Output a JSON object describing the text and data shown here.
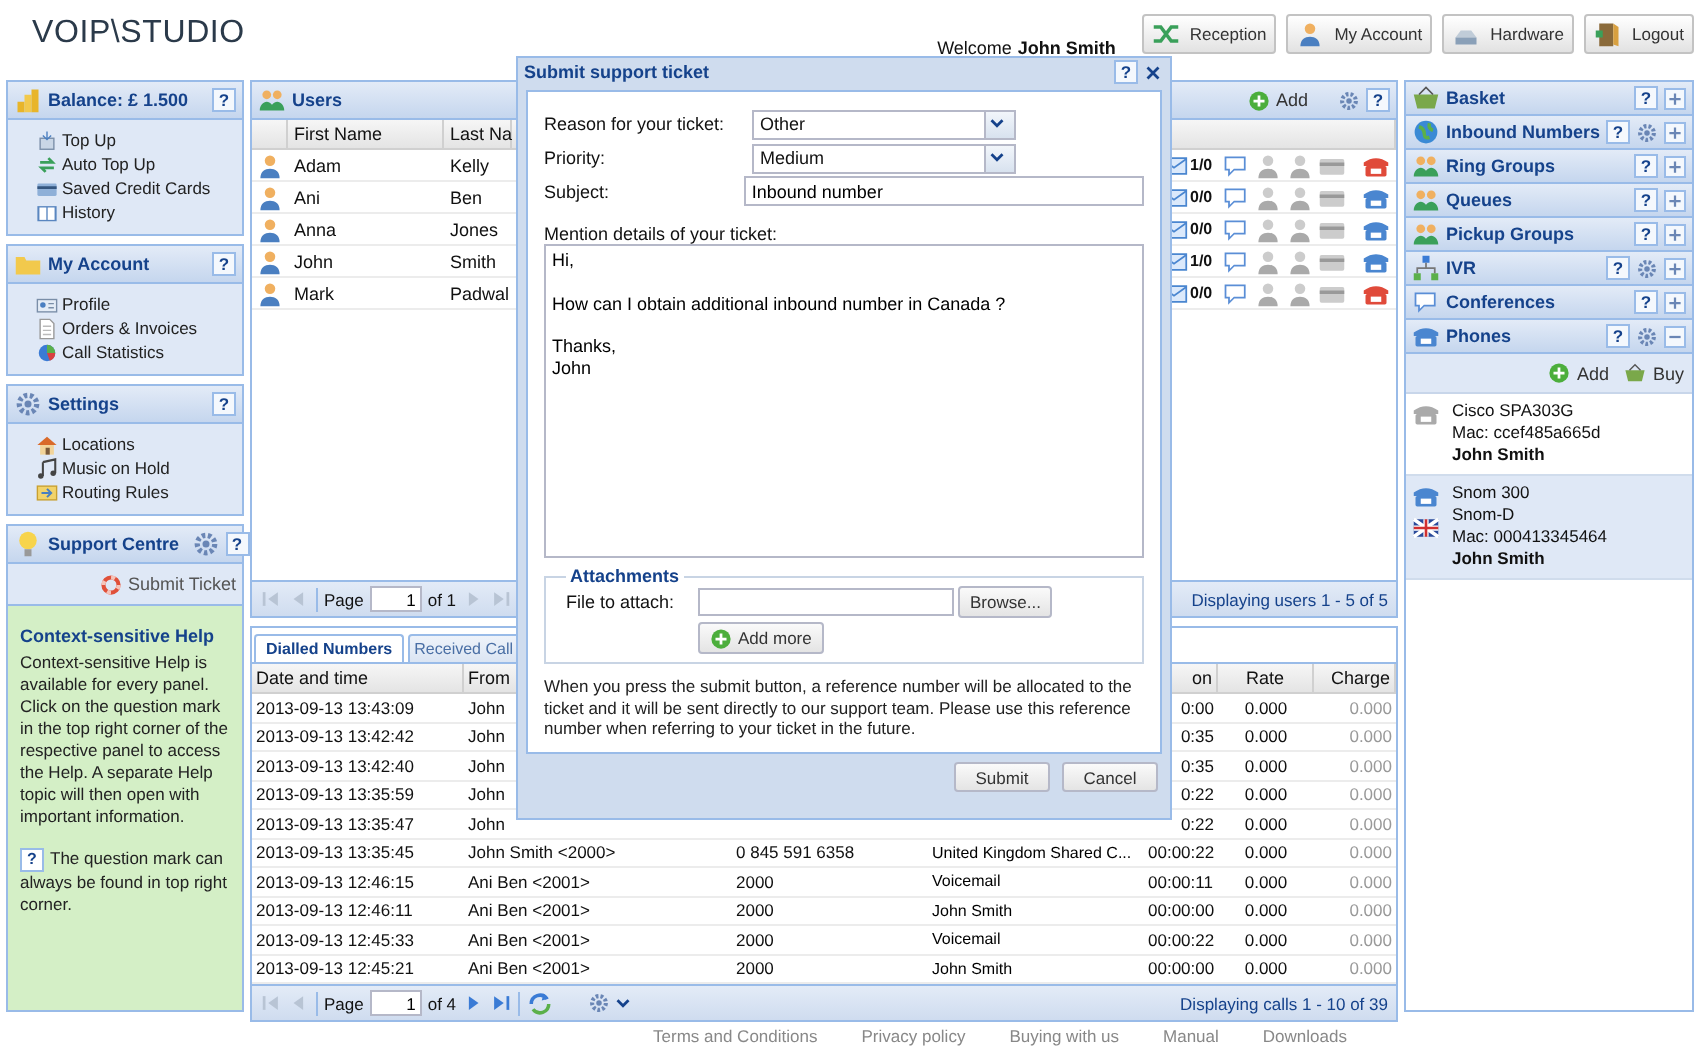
{
  "header": {
    "logo": "VOIP\\STUDIO",
    "welcome": "Welcome",
    "user": "John Smith",
    "buttons": [
      "Reception",
      "My Account",
      "Hardware",
      "Logout"
    ]
  },
  "left_panels": [
    {
      "title": "Balance: £ 1.500",
      "help": "?",
      "items": [
        "Top Up",
        "Auto Top Up",
        "Saved Credit Cards",
        "History"
      ]
    },
    {
      "title": "My Account",
      "help": "?",
      "items": [
        "Profile",
        "Orders & Invoices",
        "Call Statistics"
      ]
    },
    {
      "title": "Settings",
      "help": "?",
      "items": [
        "Locations",
        "Music on Hold",
        "Routing Rules"
      ]
    }
  ],
  "support": {
    "title": "Support Centre",
    "help": "?",
    "link": "Submit Ticket",
    "help_title": "Context-sensitive Help",
    "help_text": "Context-sensitive Help is available for every panel. Click on the question mark in the top right corner of the respective panel to access the Help. A separate Help topic will then open with important information.",
    "note_icon": "?",
    "note": "The question mark can always be found in top right corner."
  },
  "users": {
    "title": "Users",
    "add": "Add",
    "help": "?",
    "columns": [
      "First Name",
      "Last Na"
    ],
    "rows": [
      {
        "first_name": "Adam",
        "last_name": "Kelly",
        "messages": "1/0",
        "available": false
      },
      {
        "first_name": "Ani",
        "last_name": "Ben",
        "messages": "0/0",
        "available": true
      },
      {
        "first_name": "Anna",
        "last_name": "Jones",
        "messages": "0/0",
        "available": true
      },
      {
        "first_name": "John",
        "last_name": "Smith",
        "messages": "1/0",
        "available": true
      },
      {
        "first_name": "Mark",
        "last_name": "Padwal",
        "messages": "0/0",
        "available": false
      }
    ],
    "pager": {
      "page_label": "Page",
      "page": "1",
      "of": "of 1",
      "can_prev": false,
      "can_next": false,
      "display": "Displaying users 1 - 5 of 5"
    }
  },
  "calls": {
    "tabs": [
      {
        "label": "Dialled Numbers",
        "selected": true
      },
      {
        "label": "Received Call",
        "selected": false
      }
    ],
    "columns": {
      "date": "Date and time",
      "from": "From",
      "duration": "on",
      "rate": "Rate",
      "charge": "Charge"
    },
    "rows": [
      {
        "date": "2013-09-13 13:43:09",
        "from": "John",
        "duration": "0:00",
        "rate": "0.000",
        "charge": "0.000"
      },
      {
        "date": "2013-09-13 13:42:42",
        "from": "John",
        "duration": "0:35",
        "rate": "0.000",
        "charge": "0.000"
      },
      {
        "date": "2013-09-13 13:42:40",
        "from": "John",
        "duration": "0:35",
        "rate": "0.000",
        "charge": "0.000"
      },
      {
        "date": "2013-09-13 13:35:59",
        "from": "John",
        "duration": "0:22",
        "rate": "0.000",
        "charge": "0.000"
      },
      {
        "date": "2013-09-13 13:35:47",
        "from": "John",
        "duration": "0:22",
        "rate": "0.000",
        "charge": "0.000"
      },
      {
        "date": "2013-09-13 13:35:45",
        "from": "John Smith <2000>",
        "to": "0 845 591 6358",
        "name": "United Kingdom Shared C...",
        "duration": "00:00:22",
        "rate": "0.000",
        "charge": "0.000"
      },
      {
        "date": "2013-09-13 12:46:15",
        "from": "Ani Ben <2001>",
        "to": "2000",
        "name": "Voicemail",
        "duration": "00:00:11",
        "rate": "0.000",
        "charge": "0.000"
      },
      {
        "date": "2013-09-13 12:46:11",
        "from": "Ani Ben <2001>",
        "to": "2000",
        "name": "John Smith",
        "duration": "00:00:00",
        "rate": "0.000",
        "charge": "0.000"
      },
      {
        "date": "2013-09-13 12:45:33",
        "from": "Ani Ben <2001>",
        "to": "2000",
        "name": "Voicemail",
        "duration": "00:00:22",
        "rate": "0.000",
        "charge": "0.000"
      },
      {
        "date": "2013-09-13 12:45:21",
        "from": "Ani Ben <2001>",
        "to": "2000",
        "name": "John Smith",
        "duration": "00:00:00",
        "rate": "0.000",
        "charge": "0.000"
      }
    ],
    "pager": {
      "page_label": "Page",
      "page": "1",
      "of": "of 4",
      "can_prev": false,
      "can_next": true,
      "display": "Displaying calls 1 - 10 of 39"
    }
  },
  "right_panels": [
    {
      "title": "Basket",
      "help": "?",
      "settings": false,
      "expanded": false
    },
    {
      "title": "Inbound Numbers",
      "help": "?",
      "settings": true,
      "expanded": false
    },
    {
      "title": "Ring Groups",
      "help": "?",
      "settings": false,
      "expanded": false
    },
    {
      "title": "Queues",
      "help": "?",
      "settings": false,
      "expanded": false
    },
    {
      "title": "Pickup Groups",
      "help": "?",
      "settings": false,
      "expanded": false
    },
    {
      "title": "IVR",
      "help": "?",
      "settings": true,
      "expanded": false
    },
    {
      "title": "Conferences",
      "help": "?",
      "settings": false,
      "expanded": false
    },
    {
      "title": "Phones",
      "help": "?",
      "settings": true,
      "expanded": true
    }
  ],
  "phones": {
    "add": "Add",
    "buy": "Buy",
    "items": [
      {
        "lines": [
          "Cisco SPA303G",
          "Mac: ccef485a665d"
        ],
        "owner": "John Smith",
        "registered": false,
        "flag": false,
        "selected": false
      },
      {
        "lines": [
          "Snom 300",
          "Snom-D",
          "Mac: 000413345464"
        ],
        "owner": "John Smith",
        "registered": true,
        "flag": true,
        "selected": true
      }
    ]
  },
  "dialog": {
    "title": "Submit support ticket",
    "help": "?",
    "fields": [
      {
        "label": "Reason for your ticket:",
        "kind": "select",
        "value": "Other"
      },
      {
        "label": "Priority:",
        "kind": "select",
        "value": "Medium"
      },
      {
        "label": "Subject:",
        "kind": "text",
        "value": "Inbound number"
      }
    ],
    "details_label": "Mention details of your ticket:",
    "details": "Hi,\n\nHow can I obtain additional inbound number in Canada ?\n\nThanks,\nJohn",
    "attachments": {
      "legend": "Attachments",
      "label": "File to attach:",
      "browse": "Browse...",
      "add_more": "Add more"
    },
    "note": "When you press the submit button, a reference number will be allocated to the ticket and it will be sent directly to our support team. Please use this reference number when referring to your ticket in the future.",
    "buttons": [
      "Submit",
      "Cancel"
    ]
  },
  "footer": [
    "Terms and Conditions",
    "Privacy policy",
    "Buying with us",
    "Manual",
    "Downloads"
  ]
}
